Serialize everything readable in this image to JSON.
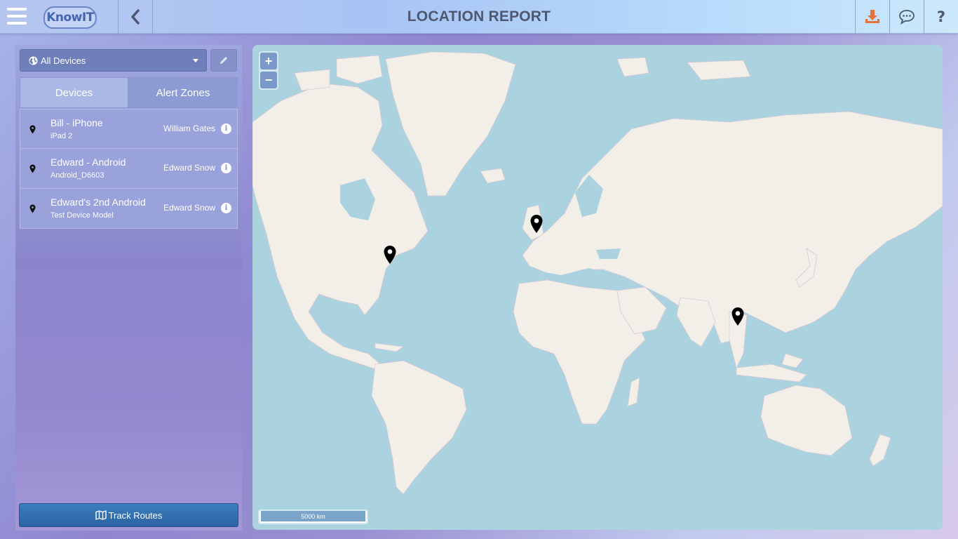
{
  "header": {
    "title": "LOCATION REPORT",
    "logo_text": "KnowIT",
    "icons": {
      "menu": "menu-icon",
      "back": "chevron-left-icon",
      "download": "download-icon",
      "chat": "chat-icon",
      "help": "help-icon"
    },
    "download_color": "#e4733d",
    "help_label": "?"
  },
  "sidebar": {
    "device_filter": {
      "selected": "All Devices",
      "icon": "globe-icon"
    },
    "tabs": [
      {
        "label": "Devices",
        "active": true
      },
      {
        "label": "Alert Zones",
        "active": false
      }
    ],
    "devices": [
      {
        "name": "Bill - iPhone",
        "model": "iPad 2",
        "owner": "William Gates"
      },
      {
        "name": "Edward - Android",
        "model": "Android_D6603",
        "owner": "Edward Snow"
      },
      {
        "name": "Edward's 2nd Android",
        "model": "Test Device Model",
        "owner": "Edward Snow"
      }
    ],
    "track_routes_label": "Track Routes"
  },
  "map": {
    "zoom_in": "+",
    "zoom_out": "−",
    "scale_label": "5000 km",
    "water_color": "#aad3df",
    "land_color": "#f2efe9"
  }
}
